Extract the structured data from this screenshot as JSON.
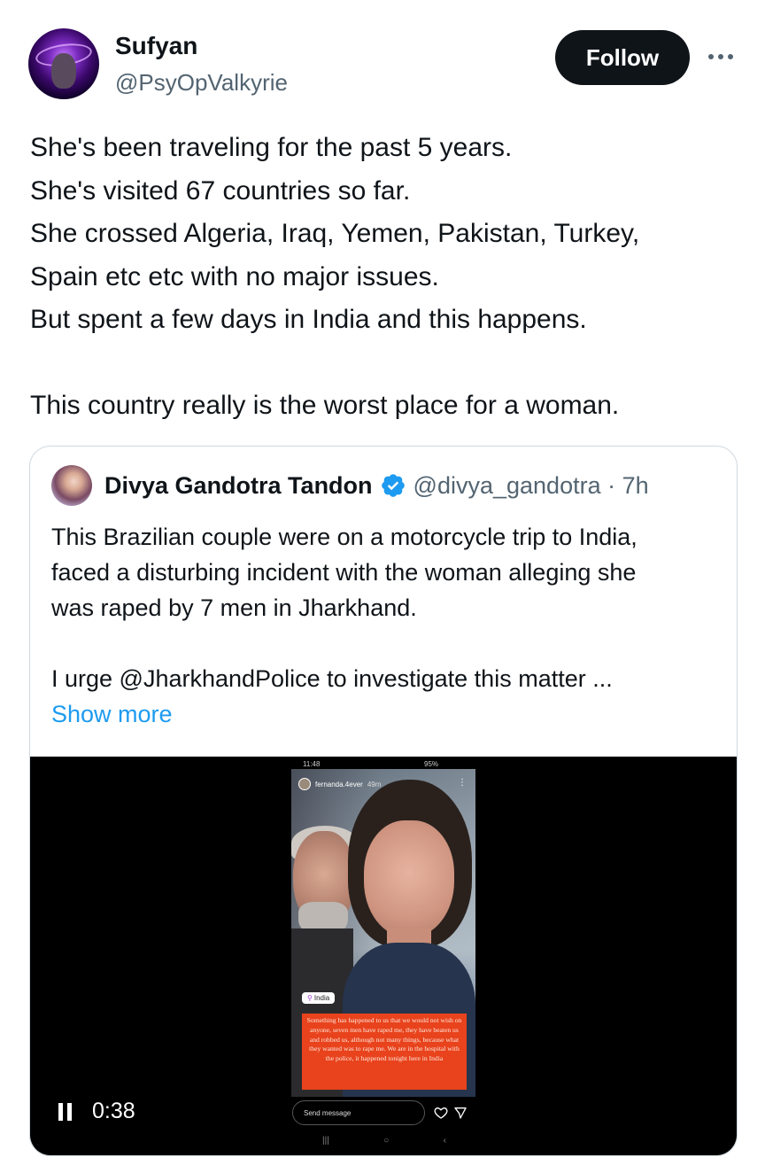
{
  "author": {
    "name": "Sufyan",
    "handle": "@PsyOpValkyrie"
  },
  "header": {
    "follow_label": "Follow"
  },
  "tweet": {
    "lines": [
      "She's been traveling for the past 5 years.",
      "She's visited 67 countries so far.",
      "She crossed Algeria, Iraq, Yemen, Pakistan, Turkey,",
      "Spain etc etc with no major issues.",
      "But spent a few days in India and this happens.",
      "This country really is the worst place for a woman."
    ]
  },
  "quote": {
    "name": "Divya Gandotra Tandon",
    "handle_time": "@divya_gandotra · 7h",
    "lines": [
      "This Brazilian couple were on a motorcycle trip to India,",
      "faced a disturbing incident with the woman alleging she",
      "was raped by 7 men in Jharkhand.",
      "I urge @JharkhandPolice to investigate this matter ..."
    ],
    "show_more": "Show more",
    "verified_color": "#1d9bf0"
  },
  "video": {
    "time": "0:38",
    "status_time": "11:48",
    "status_right": "95%",
    "story_user": "fernanda.4ever",
    "story_age": "49m",
    "location": "India",
    "caption": "Something has happened to us that we would not wish on anyone, seven men have raped me, they have beaten us and robbed us, although not many things, because what they wanted was to rape me. We are in the hospital with the police, it happened tonight here in India",
    "send_placeholder": "Send message",
    "caption_color": "#e8431c"
  }
}
